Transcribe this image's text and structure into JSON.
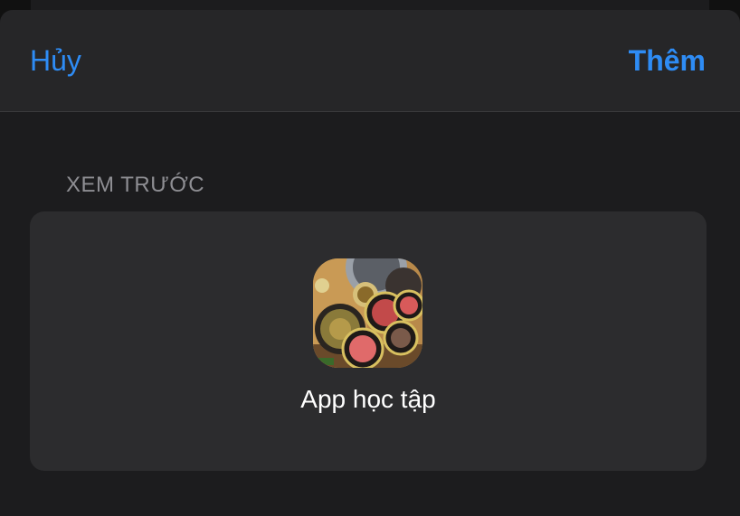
{
  "nav": {
    "cancel_label": "Hủy",
    "add_label": "Thêm"
  },
  "preview": {
    "section_title": "XEM TRƯỚC",
    "app_name": "App học tập",
    "icon": "food-photo-icon"
  },
  "colors": {
    "accent": "#2e8cf5",
    "background": "#1c1c1e",
    "card": "#2c2c2e",
    "secondary_text": "#8e8e93"
  }
}
